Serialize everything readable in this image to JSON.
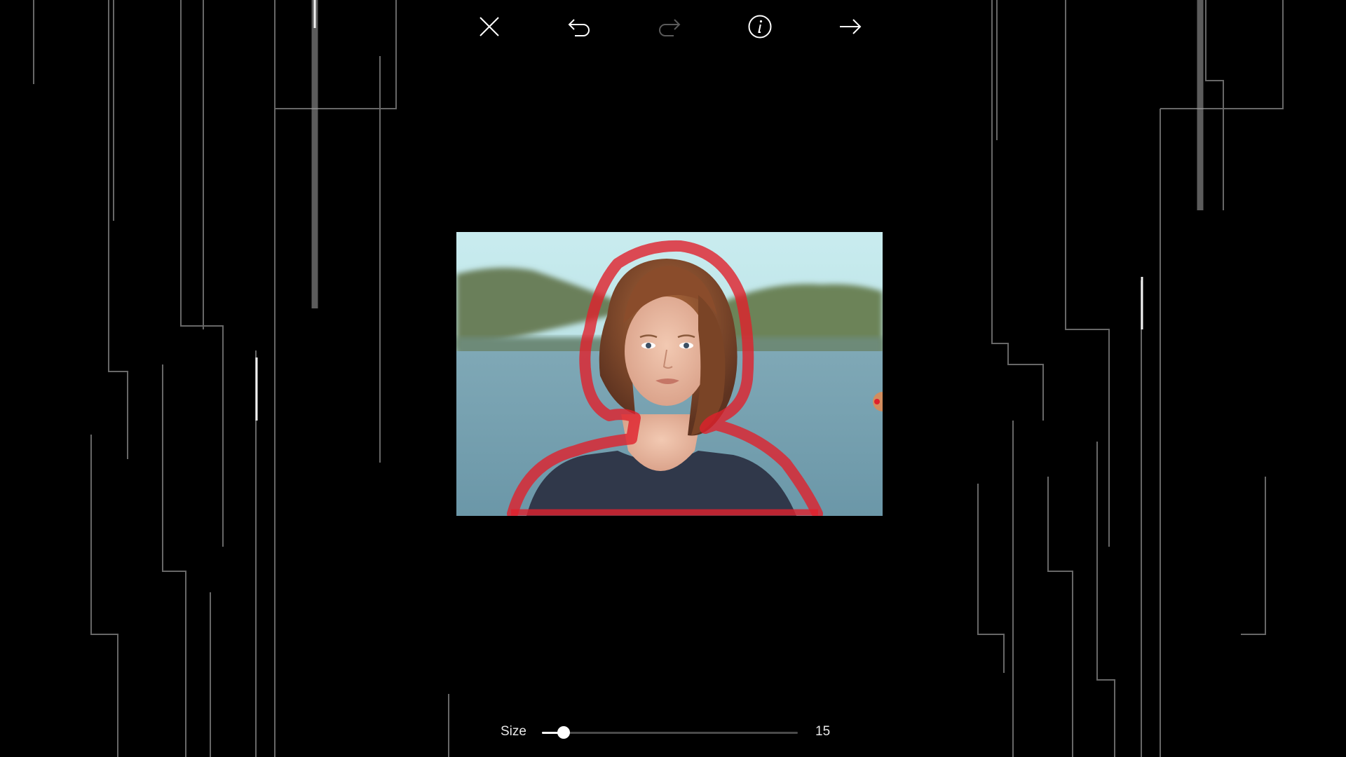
{
  "toolbar": {
    "close_icon": "close-icon",
    "undo_icon": "undo-icon",
    "redo_icon": "redo-icon",
    "info_icon": "info-icon",
    "next_icon": "arrow-right-icon",
    "redo_enabled": false
  },
  "editor": {
    "selection_color": "#e0202c",
    "photo_subject": "portrait"
  },
  "size_control": {
    "label": "Size",
    "value": "15",
    "fill_fraction": 0.085
  }
}
